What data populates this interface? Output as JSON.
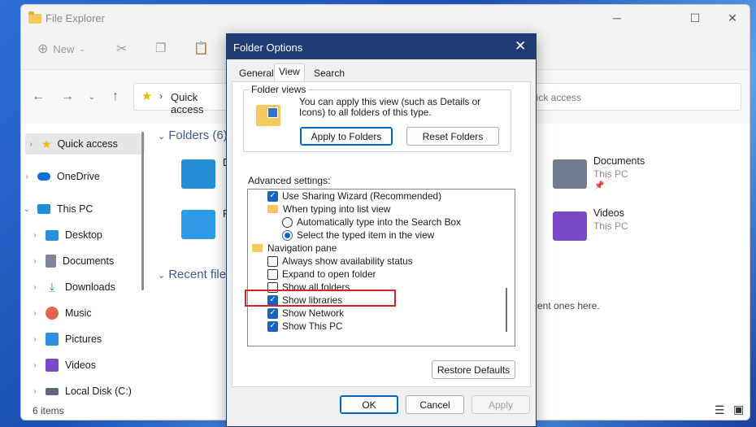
{
  "explorer": {
    "title": "File Explorer",
    "cmd_new": "New",
    "address_label": "Quick access",
    "search_text": "uick access",
    "status_items": "6 items",
    "sidebar": [
      {
        "label": "Quick access",
        "icon": "star-icon",
        "color": "#f0b800"
      },
      {
        "label": "OneDrive",
        "icon": "cloud-icon",
        "color": "#0a6fd6"
      },
      {
        "label": "This PC",
        "icon": "monitor-icon",
        "color": "#1f8fd8"
      },
      {
        "label": "Desktop",
        "icon": "desktop-icon",
        "color": "#2a90e0"
      },
      {
        "label": "Documents",
        "icon": "documents-icon",
        "color": "#7a8797"
      },
      {
        "label": "Downloads",
        "icon": "downloads-icon",
        "color": "#1e9c56"
      },
      {
        "label": "Music",
        "icon": "music-icon",
        "color": "#e2654a"
      },
      {
        "label": "Pictures",
        "icon": "pictures-icon",
        "color": "#2d8fe3"
      },
      {
        "label": "Videos",
        "icon": "videos-icon",
        "color": "#7b49c8"
      },
      {
        "label": "Local Disk (C:)",
        "icon": "disk-icon",
        "color": "#5a6a7a"
      }
    ],
    "folders_header": "Folders (6)",
    "recent_header": "Recent file",
    "recent_msg": "cent ones here.",
    "folder_left_1": "D",
    "folder_left_2": "P",
    "documents": {
      "name": "Documents",
      "sub": "This PC"
    },
    "videos": {
      "name": "Videos",
      "sub": "This PC"
    }
  },
  "dialog": {
    "title": "Folder Options",
    "tabs": [
      "General",
      "View",
      "Search"
    ],
    "folder_views_legend": "Folder views",
    "folder_views_desc": "You can apply this view (such as Details or Icons) to all folders of this type.",
    "apply_btn": "Apply to Folders",
    "reset_btn": "Reset Folders",
    "advanced_label": "Advanced settings:",
    "rows": [
      {
        "type": "checkbox",
        "checked": true,
        "label": "Use Sharing Wizard (Recommended)",
        "indent": 1
      },
      {
        "type": "folder",
        "label": "When typing into list view",
        "indent": 1
      },
      {
        "type": "radio",
        "checked": false,
        "label": "Automatically type into the Search Box",
        "indent": 2
      },
      {
        "type": "radio",
        "checked": true,
        "label": "Select the typed item in the view",
        "indent": 2
      },
      {
        "type": "folder",
        "label": "Navigation pane",
        "indent": 0
      },
      {
        "type": "checkbox",
        "checked": false,
        "label": "Always show availability status",
        "indent": 1
      },
      {
        "type": "checkbox",
        "checked": false,
        "label": "Expand to open folder",
        "indent": 1
      },
      {
        "type": "checkbox",
        "checked": false,
        "label": "Show all folders",
        "indent": 1
      },
      {
        "type": "checkbox",
        "checked": true,
        "label": "Show libraries",
        "indent": 1
      },
      {
        "type": "checkbox",
        "checked": true,
        "label": "Show Network",
        "indent": 1
      },
      {
        "type": "checkbox",
        "checked": true,
        "label": "Show This PC",
        "indent": 1
      }
    ],
    "restore_btn": "Restore Defaults",
    "ok_btn": "OK",
    "cancel_btn": "Cancel",
    "apply_footer_btn": "Apply",
    "highlight_color": "#d1232a"
  }
}
